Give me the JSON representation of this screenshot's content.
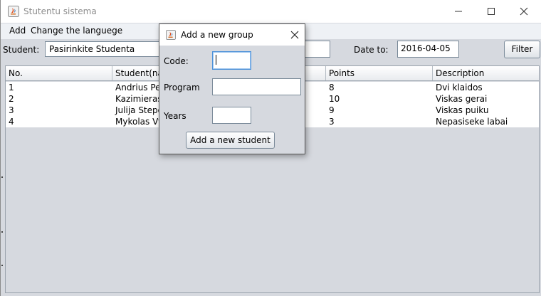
{
  "window": {
    "title": "Stutentu sistema"
  },
  "menu": {
    "items": [
      "Add",
      "Change the languege"
    ]
  },
  "toolbar": {
    "student_label": "Student:",
    "student_select": "Pasirinkite Studenta",
    "date_to_label": "Date to:",
    "date_to_value": "2016-04-05",
    "filter_button": "Filter"
  },
  "table": {
    "columns": [
      "No.",
      "Student(name)",
      "",
      "Points",
      "Description"
    ],
    "visible_columns": [
      "No.",
      "Student(nam",
      "Points",
      "Description"
    ],
    "rows": [
      {
        "no": "1",
        "student": "Andrius Pet",
        "points": "8",
        "description": "Dvi klaidos"
      },
      {
        "no": "2",
        "student": "Kazimieras",
        "points": "10",
        "description": "Viskas gerai"
      },
      {
        "no": "3",
        "student": "Julija Stepo",
        "points": "9",
        "description": "Viskas puiku"
      },
      {
        "no": "4",
        "student": "Mykolas Vyt",
        "points": "3",
        "description": "Nepasiseke labai"
      }
    ]
  },
  "dialog": {
    "title": "Add a new group",
    "code_label": "Code:",
    "code_value": "",
    "program_label": "Program",
    "program_value": "",
    "years_label": "Years",
    "years_value": "",
    "submit_button": "Add a new student"
  },
  "colors": {
    "window_bg": "#d6d9df",
    "focus_border": "#4a90d9"
  },
  "icons": {
    "app": "java-coffee-icon",
    "minimize": "minimize-icon",
    "maximize": "maximize-icon",
    "close": "close-icon"
  }
}
